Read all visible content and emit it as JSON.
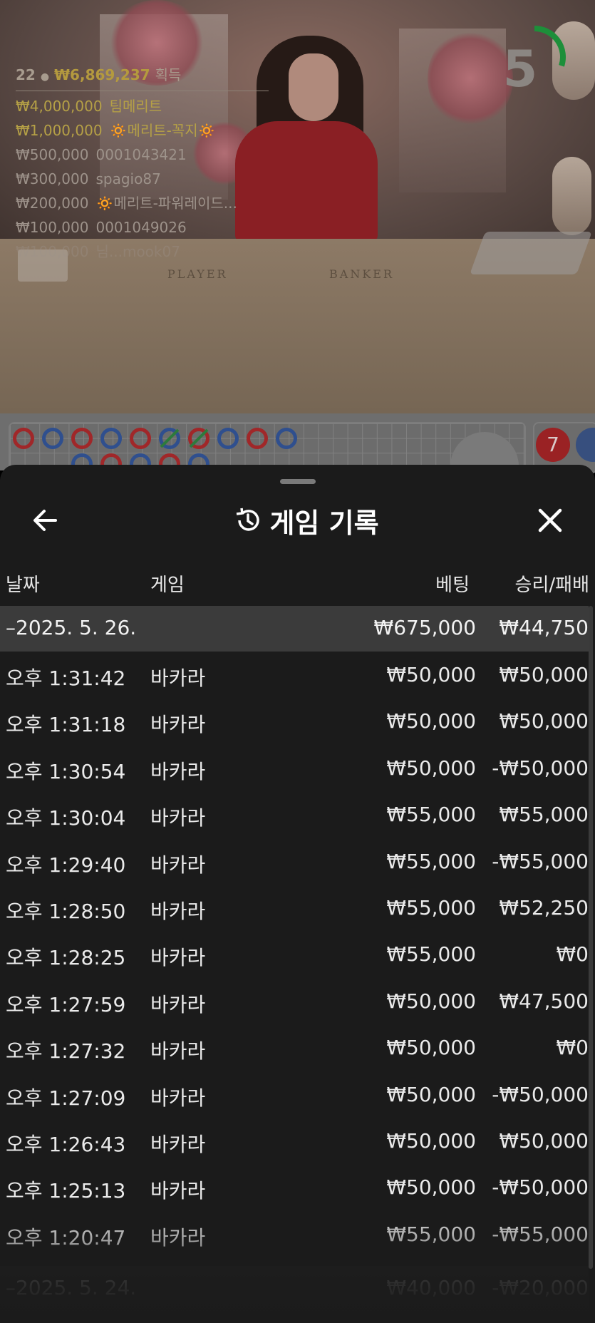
{
  "leaderboard": {
    "count": "22",
    "total": "₩6,869,237",
    "suffix": "획득",
    "rows": [
      {
        "amount": "₩4,000,000",
        "name": "팀메리트",
        "style": "gold"
      },
      {
        "amount": "₩1,000,000",
        "name": "🔅메리트-꼭지🔅",
        "style": "gold"
      },
      {
        "amount": "₩500,000",
        "name": "0001043421",
        "style": "grey"
      },
      {
        "amount": "₩300,000",
        "name": "spagio87",
        "style": "grey"
      },
      {
        "amount": "₩200,000",
        "name": "🔅메리트-파워레이드...",
        "style": "grey"
      },
      {
        "amount": "₩100,000",
        "name": "0001049026",
        "style": "grey"
      },
      {
        "amount": "₩100,000",
        "name": "님...mook07",
        "style": "faded"
      }
    ]
  },
  "table_labels": {
    "player": "PLAYER",
    "banker": "BANKER"
  },
  "timer": {
    "value": "5",
    "remaining_fraction": 0.3,
    "color": "#1d8f3a"
  },
  "road": {
    "badge": "7"
  },
  "sheet": {
    "title": "게임 기록",
    "title_icon": "history-icon",
    "columns": {
      "date": "날짜",
      "game": "게임",
      "bet": "베팅",
      "win_loss": "승리/패배"
    },
    "group": {
      "date": "–2025. 5. 26.",
      "bet": "₩675,000",
      "win_loss": "₩44,750"
    },
    "rows": [
      {
        "time": "오후 1:31:42",
        "game": "바카라",
        "bet": "₩50,000",
        "win_loss": "₩50,000"
      },
      {
        "time": "오후 1:31:18",
        "game": "바카라",
        "bet": "₩50,000",
        "win_loss": "₩50,000"
      },
      {
        "time": "오후 1:30:54",
        "game": "바카라",
        "bet": "₩50,000",
        "win_loss": "-₩50,000"
      },
      {
        "time": "오후 1:30:04",
        "game": "바카라",
        "bet": "₩55,000",
        "win_loss": "₩55,000"
      },
      {
        "time": "오후 1:29:40",
        "game": "바카라",
        "bet": "₩55,000",
        "win_loss": "-₩55,000"
      },
      {
        "time": "오후 1:28:50",
        "game": "바카라",
        "bet": "₩55,000",
        "win_loss": "₩52,250"
      },
      {
        "time": "오후 1:28:25",
        "game": "바카라",
        "bet": "₩55,000",
        "win_loss": "₩0"
      },
      {
        "time": "오후 1:27:59",
        "game": "바카라",
        "bet": "₩50,000",
        "win_loss": "₩47,500"
      },
      {
        "time": "오후 1:27:32",
        "game": "바카라",
        "bet": "₩50,000",
        "win_loss": "₩0"
      },
      {
        "time": "오후 1:27:09",
        "game": "바카라",
        "bet": "₩50,000",
        "win_loss": "-₩50,000"
      },
      {
        "time": "오후 1:26:43",
        "game": "바카라",
        "bet": "₩50,000",
        "win_loss": "₩50,000"
      },
      {
        "time": "오후 1:25:13",
        "game": "바카라",
        "bet": "₩50,000",
        "win_loss": "-₩50,000"
      },
      {
        "time": "오후 1:20:47",
        "game": "바카라",
        "bet": "₩55,000",
        "win_loss": "-₩55,000"
      }
    ],
    "next_group": {
      "date": "–2025. 5. 24.",
      "bet": "₩40,000",
      "win_loss": "-₩20,000"
    }
  }
}
